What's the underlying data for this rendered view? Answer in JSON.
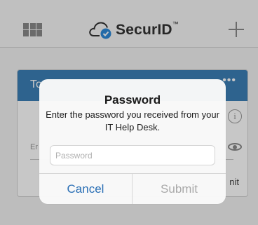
{
  "app": {
    "brand_name": "SecurID",
    "brand_mark": "™"
  },
  "card": {
    "title": "To",
    "menu_glyph": "•••",
    "info_glyph": "i",
    "field_label": "Er",
    "submit_fragment": "nit"
  },
  "dialog": {
    "title": "Password",
    "message": "Enter the password you received from your IT Help Desk.",
    "input": {
      "placeholder": "Password",
      "value": ""
    },
    "cancel_label": "Cancel",
    "submit_label": "Submit"
  },
  "colors": {
    "brand_blue": "#3b7fb6",
    "cancel_blue": "#2a6fb5",
    "disabled_gray": "#a9a9a9"
  }
}
